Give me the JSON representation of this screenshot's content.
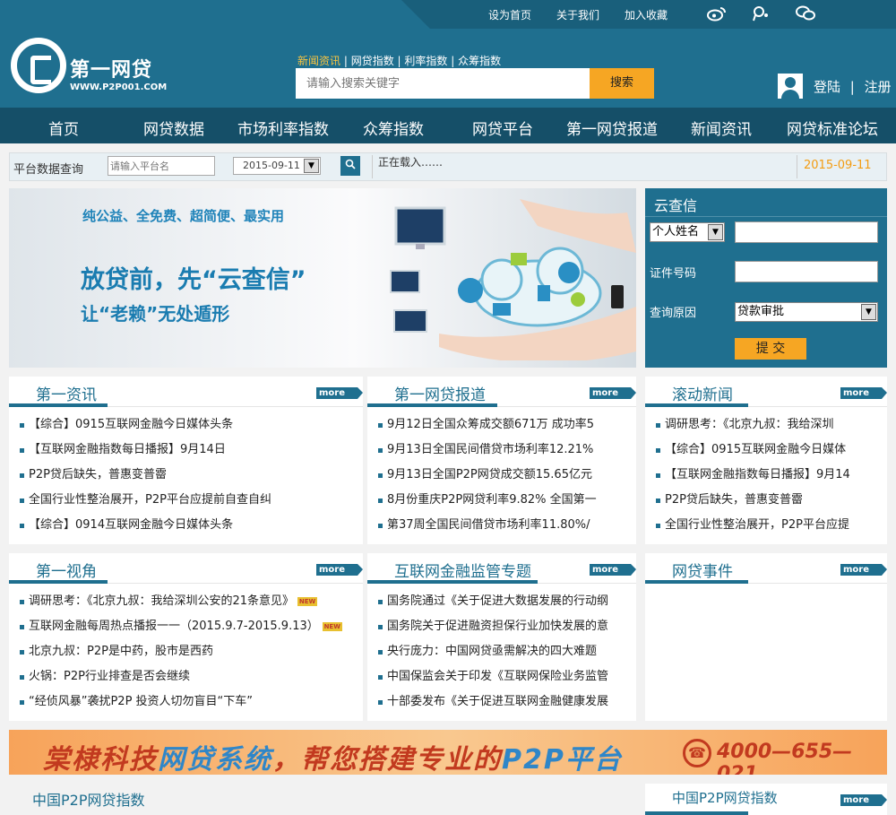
{
  "topbar": {
    "links": [
      "设为首页",
      "关于我们",
      "加入收藏"
    ],
    "icons": [
      "weibo-icon",
      "tencent-weibo-icon",
      "wechat-icon"
    ]
  },
  "logo": {
    "name": "第一网贷",
    "url": "WWW.P2P001.COM"
  },
  "search": {
    "tabs": [
      "新闻资讯",
      "网贷指数",
      "利率指数",
      "众筹指数"
    ],
    "placeholder": "请输入搜索关键字",
    "button": "搜索"
  },
  "user": {
    "login": "登陆",
    "separator": "|",
    "register": "注册"
  },
  "nav": [
    "首页",
    "网贷数据",
    "市场利率指数",
    "众筹指数",
    "网贷平台",
    "第一网贷报道",
    "新闻资讯",
    "网贷标准论坛"
  ],
  "query": {
    "label": "平台数据查询",
    "placeholder": "请输入平台名",
    "date": "2015-09-11",
    "loading": "正在载入……",
    "current_date": "2015-09-11"
  },
  "banner": {
    "line1": "纯公益、全免费、超简便、最实用",
    "line2": "放贷前，先“云查信”",
    "line3": "让“老赖”无处遁形"
  },
  "cloud": {
    "title": "云查信",
    "select": "个人姓名",
    "id_label": "证件号码",
    "reason_label": "查询原因",
    "reason_value": "贷款审批",
    "submit": "提 交"
  },
  "more_label": "more",
  "panels": [
    {
      "title": "第一资讯",
      "items": [
        "【综合】0915互联网金融今日媒体头条",
        "【互联网金融指数每日播报】9月14日",
        "P2P贷后缺失，普惠变普霤",
        "全国行业性整治展开，P2P平台应提前自查自纠",
        "【综合】0914互联网金融今日媒体头条"
      ]
    },
    {
      "title": "第一网贷报道",
      "items": [
        "9月12日全国众筹成交额671万 成功率5",
        "9月13日全国民间借贷市场利率12.21%",
        "9月13日全国P2P网贷成交额15.65亿元",
        "8月份重庆P2P网贷利率9.82% 全国第一",
        "第37周全国民间借贷市场利率11.80%/"
      ]
    },
    {
      "title": "滚动新闻",
      "items": [
        "调研思考：《北京九叔：我给深圳",
        "【综合】0915互联网金融今日媒体",
        "【互联网金融指数每日播报】9月14",
        "P2P贷后缺失，普惠变普霤",
        "全国行业性整治展开，P2P平台应提"
      ]
    },
    {
      "title": "第一视角",
      "items": [
        "调研思考：《北京九叔：我给深圳公安的21条意见》",
        "互联网金融每周热点播报一一（2015.9.7-2015.9.13）",
        "北京九叔：P2P是中药，股市是西药",
        "火锅：P2P行业排查是否会继续",
        "“经侦风暴”袭扰P2P 投资人切勿盲目“下车”"
      ],
      "new_tag": "NEW"
    },
    {
      "title": "互联网金融监管专题",
      "items": [
        "国务院通过《关于促进大数据发展的行动纲",
        "国务院关于促进融资担保行业加快发展的意",
        "央行庞力：中国网贷亟需解决的四大难题",
        "中国保监会关于印发《互联网保险业务监管",
        "十部委发布《关于促进互联网金融健康发展"
      ]
    },
    {
      "title": "网贷事件",
      "items": []
    }
  ],
  "ad": {
    "text_a": "棠棣科技",
    "text_b": "网贷系统",
    "text_c": "，帮您搭建专业的",
    "text_d": "P2P平台",
    "phone": "4000—655—021"
  },
  "bottom": {
    "left_title": "中国P2P网贷指数",
    "right_title": "中国P2P网贷指数"
  },
  "colors": {
    "primary": "#1f6f8f",
    "nav": "#154f68",
    "accent": "#f6a623",
    "date": "#f39c12"
  }
}
